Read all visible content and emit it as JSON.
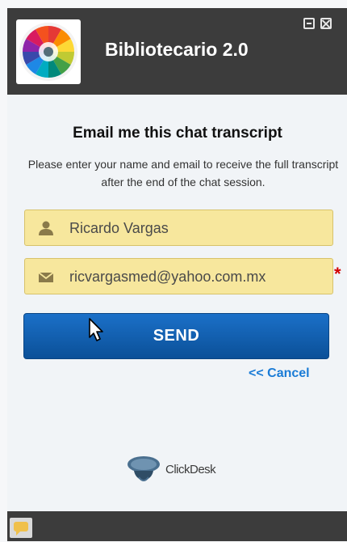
{
  "header": {
    "title": "Bibliotecario 2.0"
  },
  "form": {
    "heading": "Email me this chat transcript",
    "subtext": "Please enter your name and email to receive the full transcript after the end of the chat session.",
    "name_value": "Ricardo Vargas",
    "email_value": "ricvargasmed@yahoo.com.mx",
    "required_mark": "*",
    "send_label": "SEND",
    "cancel_label": "<< Cancel"
  },
  "branding": {
    "name": "ClickDesk"
  },
  "colors": {
    "header_bg": "#3c3c3c",
    "field_bg": "#f7e79d",
    "button_bg": "#0b5fae",
    "link": "#1a7bd6",
    "required": "#d20000"
  },
  "icons": {
    "name_field": "user-icon",
    "email_field": "envelope-icon",
    "minimize": "minimize-icon",
    "close": "close-icon",
    "footer": "chat-bubble-icon"
  }
}
